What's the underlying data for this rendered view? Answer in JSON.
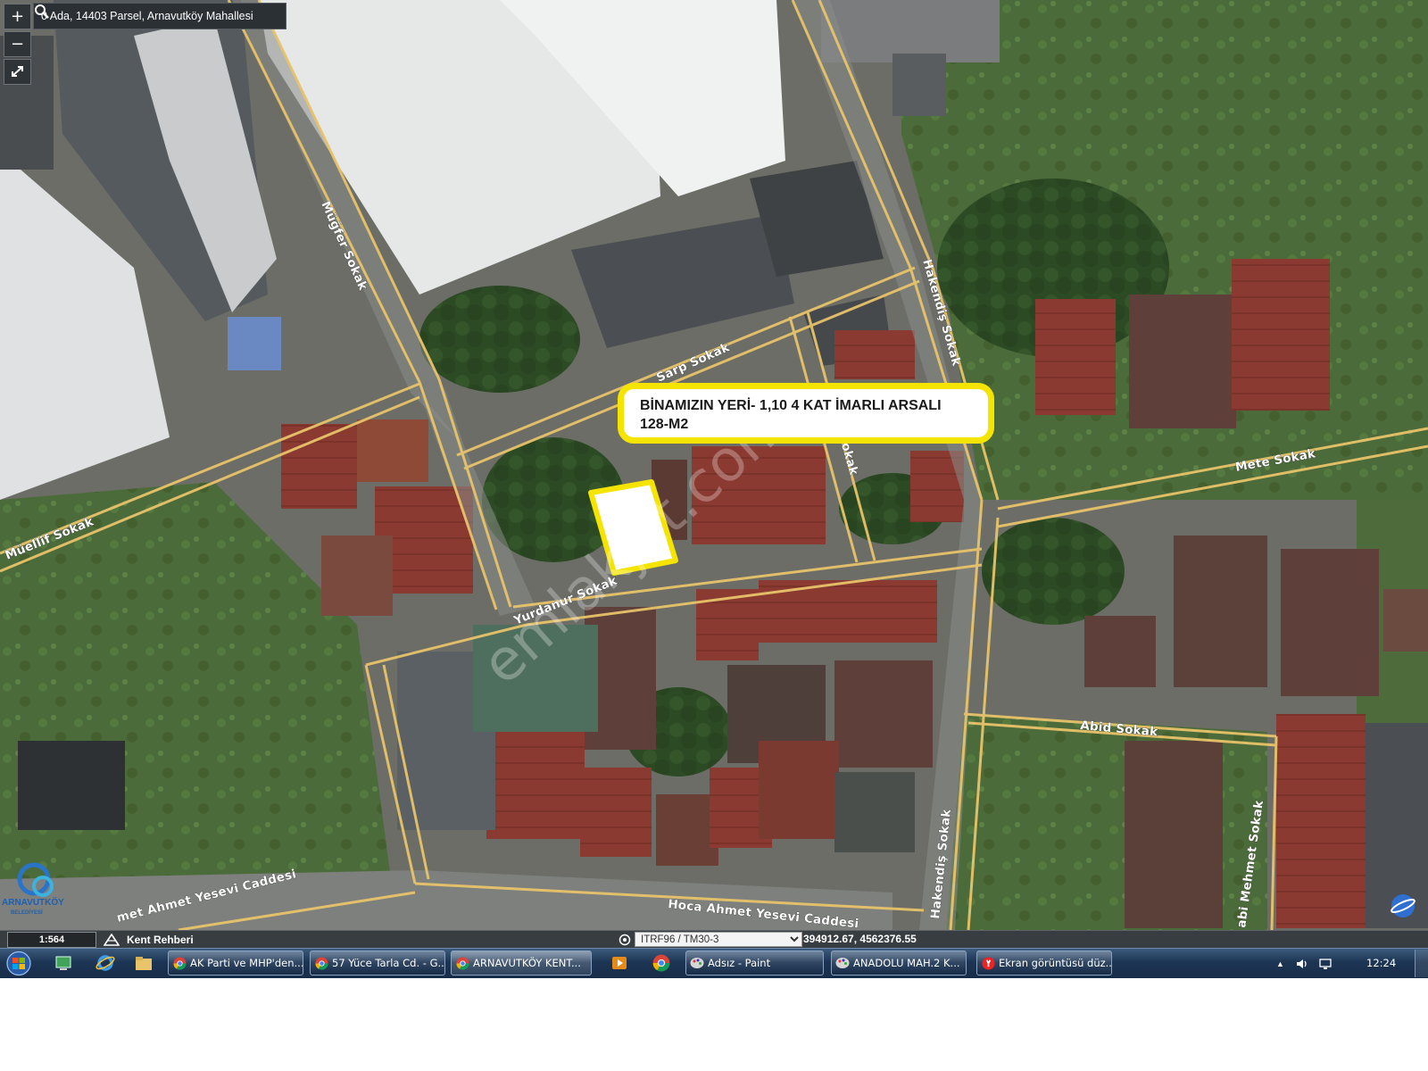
{
  "map": {
    "search_value": "0 Ada, 14403 Parsel, Arnavutköy Mahallesi",
    "zoom_in_label": "+",
    "zoom_out_label": "−",
    "streets": {
      "mugfer": "Müğfer Sokak",
      "sarp": "Sarp Sokak",
      "muellif": "Müellif Sokak",
      "hakendis_top": "Hakendiş Sokak",
      "hakendis_bottom": "Hakendiş Sokak",
      "sokak_fragment": "Sokak",
      "mete": "Mete Sokak",
      "yurdanur": "Yurdanur Sokak",
      "abid": "Abid Sokak",
      "hoca": "Hoca Ahmet Yesevi Caddesi",
      "ahmet_left": "met Ahmet Yesevi Caddesi",
      "mehmet": "abi Mehmet Sokak"
    },
    "annotation": {
      "line1": "BİNAMIZIN YERİ- 1,10 4 KAT İMARLI ARSALI",
      "line2": "128-M2"
    },
    "watermark": "emlakjet.com",
    "logo_text": {
      "line1": "ARNAVUTKÖY",
      "line2": "BELEDİYESİ"
    },
    "colors": {
      "road_outline": "#e8c36a",
      "highlight": "#f4e400",
      "parcel_fill": "#ffffff"
    }
  },
  "status_bar": {
    "scale": "1:564",
    "kent_rehberi": "Kent Rehberi",
    "crs_selected": "ITRF96 / TM30-3",
    "coordinates": "394912.67, 4562376.55"
  },
  "taskbar": {
    "buttons": [
      {
        "label": "AK Parti ve MHP'den...",
        "icon": "chrome-icon"
      },
      {
        "label": "57 Yüce Tarla Cd. - G...",
        "icon": "chrome-icon"
      },
      {
        "label": "ARNAVUTKÖY KENT...",
        "icon": "chrome-icon"
      },
      {
        "label": "Adsız - Paint",
        "icon": "paint-icon"
      },
      {
        "label": "ANADOLU MAH.2 K...",
        "icon": "paint-icon"
      },
      {
        "label": "Ekran görüntüsü düz...",
        "icon": "yandex-icon"
      }
    ],
    "clock": "12:24"
  }
}
